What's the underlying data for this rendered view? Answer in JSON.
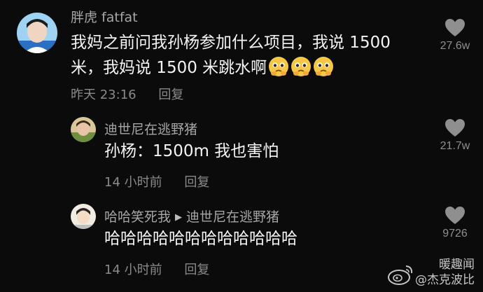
{
  "comments": [
    {
      "username": "胖虎 fatfat",
      "text_line1": "我妈之前问我孙杨参加什么项目，我说 1500",
      "text_line2": "米，我妈说 1500 米跳水啊",
      "emoji": "pleading-face",
      "time": "昨天 23:16",
      "reply_label": "回复",
      "like_count": "27.6w"
    },
    {
      "username": "迪世尼在逃野猪",
      "text": "孙杨：1500m 我也害怕",
      "time": "14 小时前",
      "reply_label": "回复",
      "like_count": "21.7w"
    },
    {
      "username": "哈哈笑死我",
      "reply_to": "迪世尼在逃野猪",
      "text": "哈哈哈哈哈哈哈哈哈哈哈哈",
      "time": "14 小时前",
      "reply_label": "回复",
      "like_count": "9726"
    }
  ],
  "watermark": {
    "line1": "暖趣闻",
    "line2": "@杰克波比"
  },
  "colors": {
    "background": "#0b0b0b",
    "username": "#a6a6a6",
    "content": "#f4f4f4",
    "meta": "#8a8a8a",
    "heart": "#8f8f8f"
  }
}
